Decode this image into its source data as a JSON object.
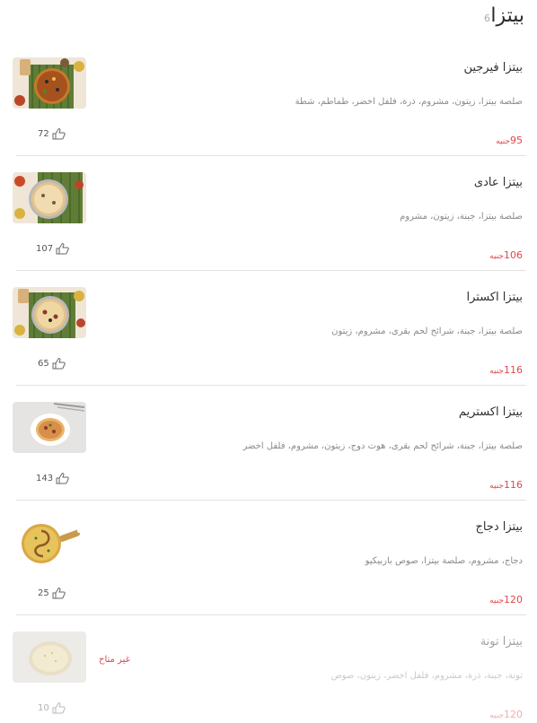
{
  "category": {
    "title": "بيتزا",
    "count": "6"
  },
  "items": [
    {
      "name": "بيتزا فيرجين",
      "desc": "صلصة بيتزا، زيتون، مشروم، ذرة، فلفل اخضر، طماطم، شطة",
      "price": "95",
      "currency": "جنيه",
      "likes": "72",
      "image_icon": "pizza-board-icon"
    },
    {
      "name": "بيتزا عادى",
      "desc": "صلصة بيتزا، جبنة، زيتون، مشروم",
      "price": "106",
      "currency": "جنيه",
      "likes": "107",
      "image_icon": "pizza-board-icon"
    },
    {
      "name": "بيتزا اكسترا",
      "desc": "صلصة بيتزا، جبنة، شرائح لحم بقرى، مشروم، زيتون",
      "price": "116",
      "currency": "جنيه",
      "likes": "65",
      "image_icon": "pizza-board-icon"
    },
    {
      "name": "بيتزا اكستريم",
      "desc": "صلصة بيتزا، جبنة، شرائح لحم بقرى، هوت دوج، زيتون، مشروم، فلفل اخضر",
      "price": "116",
      "currency": "جنيه",
      "likes": "143",
      "image_icon": "pizza-plate-icon"
    },
    {
      "name": "بيتزا دجاج",
      "desc": "دجاج، مشروم، صلصة بيتزا، صوص باربيكيو",
      "price": "120",
      "currency": "جنيه",
      "likes": "25",
      "image_icon": "pizza-peel-icon"
    },
    {
      "name": "بيتزا تونة",
      "desc": "تونة، جبنة، ذرة، مشروم، فلفل اخضر، زيتون، صوص",
      "price": "120",
      "currency": "جنيه",
      "likes": "10",
      "image_icon": "pizza-dough-icon",
      "status": "غير متاح"
    }
  ],
  "colors": {
    "price": "#e0474c",
    "divider": "#e2e2e2"
  }
}
